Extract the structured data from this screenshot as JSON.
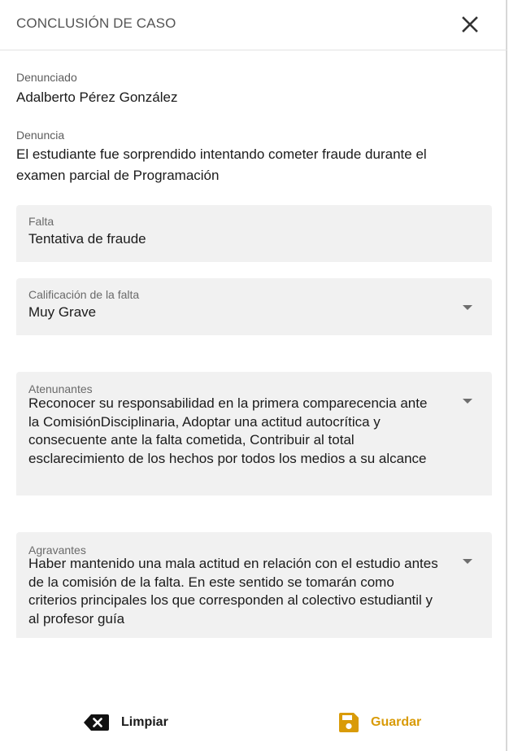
{
  "header": {
    "title": "CONCLUSIÓN DE CASO",
    "close_icon": "close-icon"
  },
  "denunciado": {
    "label": "Denunciado",
    "value": "Adalberto Pérez González"
  },
  "denuncia": {
    "label": "Denuncia",
    "value": "El estudiante fue sorprendido intentando cometer fraude durante el examen parcial de Programación"
  },
  "falta": {
    "label": "Falta",
    "value": "Tentativa de fraude"
  },
  "calificacion": {
    "label": "Calificación de la falta",
    "value": "Muy Grave",
    "icon": "chevron-down-icon"
  },
  "atenunantes": {
    "label": "Atenunantes",
    "value": "Reconocer su responsabilidad en la primera comparecencia ante la ComisiónDisciplinaria, Adoptar una actitud autocrítica y consecuente ante la falta cometida, Contribuir al total esclarecimiento de los hechos por todos los medios a su alcance",
    "icon": "chevron-down-icon"
  },
  "agravantes": {
    "label": "Agravantes",
    "value": "Haber mantenido una mala actitud en relación con el estudio antes de la comisión de la falta. En este sentido se tomarán como criterios principales los que corresponden al colectivo estudiantil y al profesor guía",
    "icon": "chevron-down-icon"
  },
  "actions": {
    "clear_label": "Limpiar",
    "clear_icon": "backspace-icon",
    "save_label": "Guardar",
    "save_icon": "save-icon"
  },
  "colors": {
    "accent": "#d99b08",
    "field_bg": "#f1f1f1",
    "text": "#1b1b1b",
    "muted": "#6a6a6a"
  }
}
